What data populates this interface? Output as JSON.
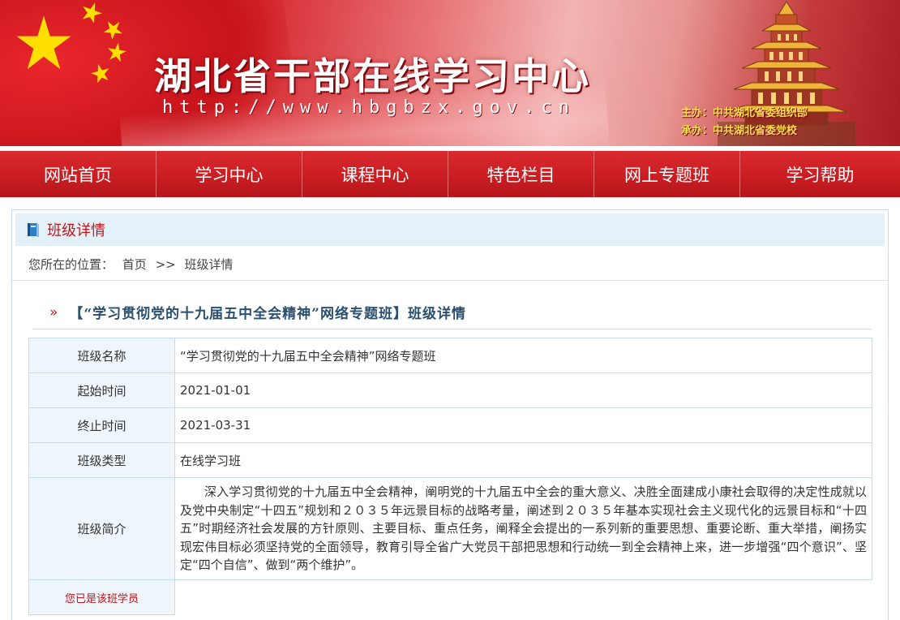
{
  "header": {
    "site_title": "湖北省干部在线学习中心",
    "site_url": "http://www.hbgbzx.gov.cn",
    "sponsor": "主办：中共湖北省委组织部",
    "organizer": "承办：中共湖北省委党校"
  },
  "nav": {
    "items": [
      "网站首页",
      "学习中心",
      "课程中心",
      "特色栏目",
      "网上专题班",
      "学习帮助"
    ]
  },
  "panel": {
    "title": "班级详情",
    "breadcrumb": {
      "prefix": "您所在的位置：",
      "home": "首页",
      "sep": ">>",
      "current": "班级详情"
    }
  },
  "detail": {
    "heading_chevron": "»",
    "heading": "【“学习贯彻党的十九届五中全会精神”网络专题班】班级详情",
    "rows": [
      {
        "label": "班级名称",
        "value": "“学习贯彻党的十九届五中全会精神”网络专题班"
      },
      {
        "label": "起始时间",
        "value": "2021-01-01"
      },
      {
        "label": "终止时间",
        "value": "2021-03-31"
      },
      {
        "label": "班级类型",
        "value": "在线学习班"
      },
      {
        "label": "班级简介",
        "value": "深入学习贯彻党的十九届五中全会精神，阐明党的十九届五中全会的重大意义、决胜全面建成小康社会取得的决定性成就以及党中央制定“十四五”规划和２０３５年远景目标的战略考量，阐述到２０３５年基本实现社会主义现代化的远景目标和“十四五”时期经济社会发展的方针原则、主要目标、重点任务，阐释全会提出的一系列新的重要思想、重要论断、重大举措，阐扬实现宏伟目标必须坚持党的全面领导，教育引导全省广大党员干部把思想和行动统一到全会精神上来，进一步增强“四个意识”、坚定“四个自信”、做到“两个维护”。"
      }
    ],
    "member_status": "您已是该班学员"
  },
  "colors": {
    "brand_red": "#c81d22",
    "panel_head_bg": "#e5f1f8",
    "label_bg": "#eef5fb",
    "title_blue": "#2b4f6e",
    "sponsor_yellow": "#ffe14d"
  }
}
